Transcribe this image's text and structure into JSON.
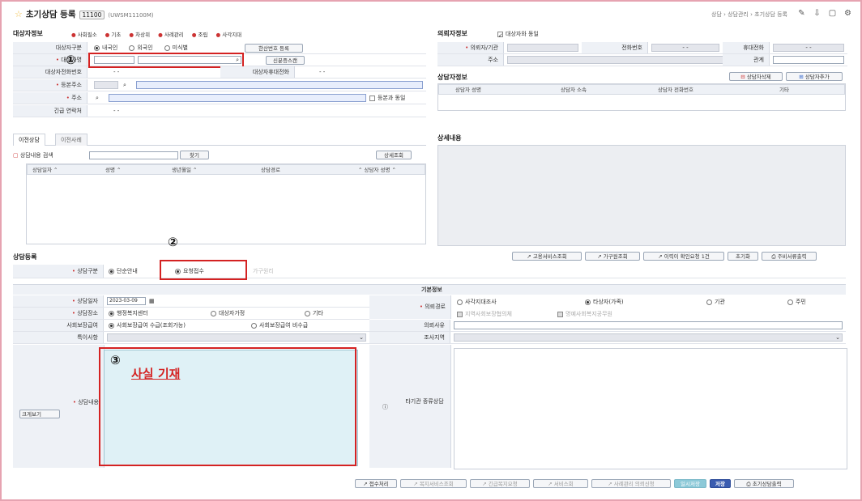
{
  "header": {
    "title": "초기상담 등록",
    "code": "11100",
    "subcode": "(UWSM11100M)",
    "breadcrumb": "상담 › 상담관리 › 초기상담 등록"
  },
  "subject": {
    "section": "대상자정보",
    "legend": [
      "사회필소",
      "기초",
      "차상위",
      "사례관리",
      "조립",
      "사각지대"
    ],
    "type_label": "대상자구분",
    "type_opts": [
      "내국인",
      "외국인",
      "미식별"
    ],
    "rrn_btn": "한산번호 등록",
    "name_label": "대상자명",
    "id_check_btn": "신분증스캔",
    "phone_label": "대상자전화번호",
    "phone_val": "-        -",
    "mobile_label": "대상자휴대전화",
    "mobile_val": "-        -",
    "addr1_label": "등본주소",
    "addr_label": "주소",
    "same_addr": "등본과 동일",
    "emergency_label": "긴급 연락처",
    "emergency_val": "-        -"
  },
  "requester": {
    "section": "의뢰자정보",
    "same_as": "대상자와 동일",
    "org_label": "의뢰자/기관",
    "phone_label": "전화번호",
    "phone_val": "-     -",
    "mobile_label": "휴대전화",
    "mobile_val": "-     -",
    "addr_label": "주소",
    "relation_label": "관계"
  },
  "counselor": {
    "section": "상담자정보",
    "del_btn": "상담자삭제",
    "add_btn": "상담자추가",
    "cols": [
      "상담자 성명",
      "상담자 소속",
      "상담자 전화번호",
      "기타"
    ]
  },
  "history": {
    "tabs": [
      "이전상담",
      "이전사례"
    ],
    "search_label": "상담내용 검색",
    "find_btn": "찾기",
    "detail_btn": "상세조회",
    "cols": [
      "상담일자",
      "성명",
      "생년월일",
      "상담경로",
      "상담자 성명"
    ]
  },
  "detail": {
    "section": "상세내용"
  },
  "register": {
    "section": "상담등록",
    "btns": [
      "고용서비스조회",
      "가구원조회",
      "이력이 확인요청 1건",
      "초기화",
      "주비서류출력"
    ],
    "kind_label": "상담구분",
    "kind_opts": [
      "단순안내",
      "요청접수"
    ],
    "kind_extra": "가구원리",
    "basic_info": "기본정보",
    "date_label": "상담일자",
    "date_val": "2023-03-09",
    "place_label": "상담장소",
    "place_opts": [
      "행정복지센터",
      "대상자가정",
      "기타"
    ],
    "social_label": "사회보장급여",
    "social_opts": [
      "사회보장급여 수급(조회가능)",
      "사회보장급여 비수급"
    ],
    "special_label": "특이사항",
    "content_label": "상담내용",
    "expand_btn": "크게보기",
    "route_label": "의뢰경로",
    "route_opts": [
      "사각지대조사",
      "타상자(가족)",
      "기관",
      "주민"
    ],
    "route_chk": [
      "지역사회보장협의체",
      "명예사회복지공무원"
    ],
    "reason_label": "의뢰사유",
    "area_label": "조사지역",
    "other_label": "타기관 종류상담",
    "annot1": "①",
    "annot2": "②",
    "annot3": "③",
    "annot3_text": "사실 기재"
  },
  "bottom": {
    "btns": [
      "접수처리",
      "복지서비스조회",
      "긴급복지요청",
      "서비스회",
      "사례관리 의뢰신청",
      "일시저장",
      "저장",
      "초기상담출력"
    ]
  }
}
